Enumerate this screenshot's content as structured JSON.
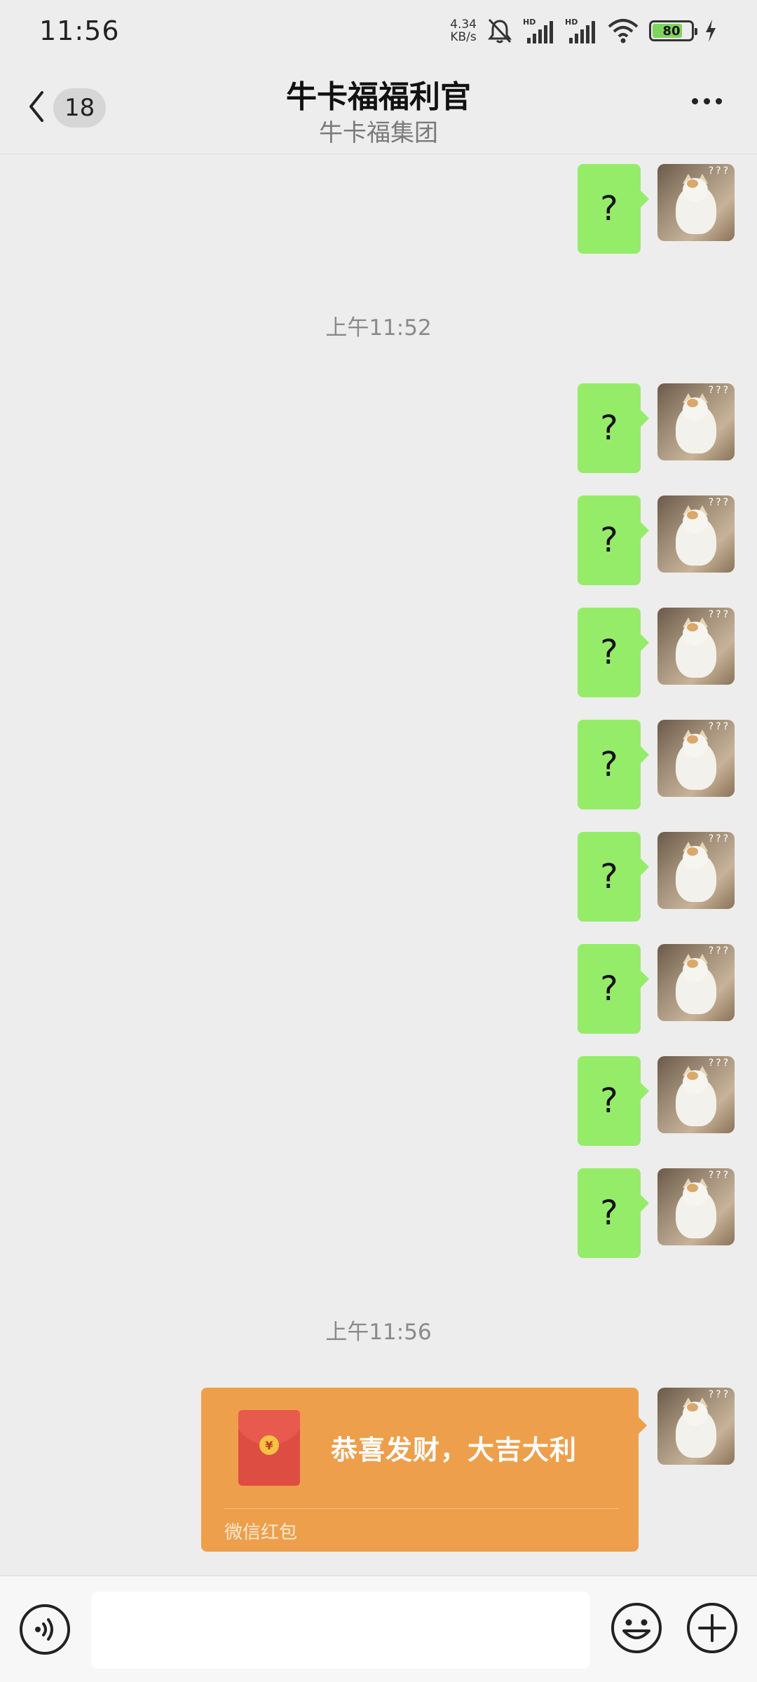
{
  "status_bar": {
    "time": "11:56",
    "net_speed_value": "4.34",
    "net_speed_unit": "KB/s",
    "battery": "80",
    "icons": [
      "mute-icon",
      "hd-signal-icon",
      "hd-signal-icon",
      "wifi-icon",
      "battery-icon",
      "charging-icon"
    ]
  },
  "header": {
    "back_badge": "18",
    "title": "牛卡福福利官",
    "subtitle": "牛卡福集团"
  },
  "timestamps": {
    "t1": "上午11:52",
    "t2": "上午11:56"
  },
  "messages": {
    "m0": "?",
    "m1": "?",
    "m2": "?",
    "m3": "?",
    "m4": "?",
    "m5": "?",
    "m6": "?",
    "m7": "?",
    "m8": "?"
  },
  "red_packet": {
    "greeting": "恭喜发财，大吉大利",
    "label": "微信红包",
    "coin_symbol": "¥"
  },
  "input_bar": {
    "value": ""
  },
  "colors": {
    "background": "#ededed",
    "bubble_green": "#95ec69",
    "red_packet_orange": "#ee9f4b",
    "envelope_red": "#de4d42"
  }
}
